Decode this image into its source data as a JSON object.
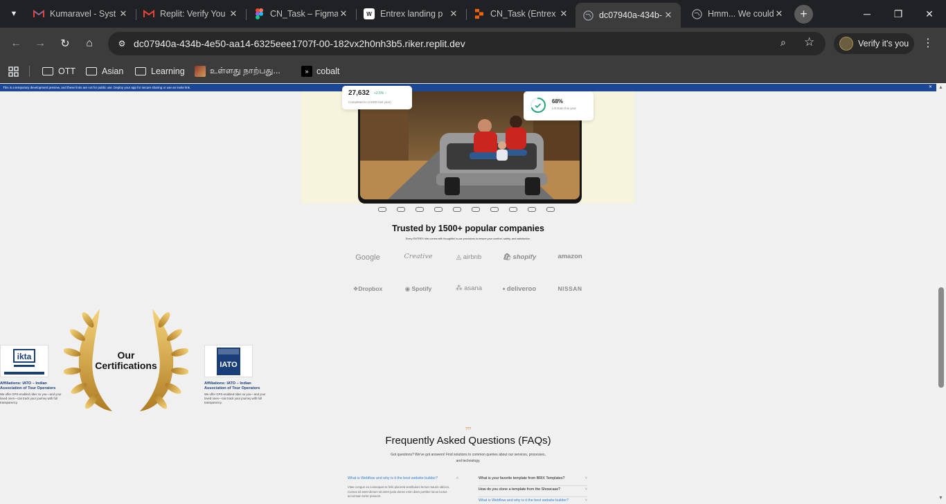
{
  "tabs": [
    {
      "title": "Kumaravel - Syst",
      "favicon": "gmail-icon"
    },
    {
      "title": "Replit: Verify You",
      "favicon": "gmail-icon"
    },
    {
      "title": "CN_Task – Figma",
      "favicon": "figma-icon"
    },
    {
      "title": "Entrex landing p",
      "favicon": "webflow-icon"
    },
    {
      "title": "CN_Task (Entrex",
      "favicon": "replit-icon"
    },
    {
      "title": "dc07940a-434b-",
      "favicon": "globe-icon",
      "active": true
    },
    {
      "title": "Hmm... We could",
      "favicon": "globe-icon"
    }
  ],
  "address_bar": {
    "url": "dc07940a-434b-4e50-aa14-6325eee1707f-00-182vx2h0nh3b5.riker.replit.dev"
  },
  "profile": {
    "label": "Verify it's you"
  },
  "bookmarks": [
    {
      "label": "OTT",
      "icon": "folder-icon"
    },
    {
      "label": "Asian",
      "icon": "folder-icon"
    },
    {
      "label": "Learning",
      "icon": "folder-icon"
    },
    {
      "label": "உள்ளது நாற்பது...",
      "icon": "image-icon"
    },
    {
      "label": "cobalt",
      "icon": "cobalt-icon"
    }
  ],
  "notice": {
    "text": "This is a temporary development preview, and these links are not for public use. Deploy your app for secure sharing or use an invite link."
  },
  "hero": {
    "stat1": {
      "value": "27,632",
      "change": "+2.5% ↑",
      "caption": "Completed to (21000 last year)"
    },
    "stat2": {
      "value": "68%",
      "caption": "Lift Rate this year",
      "progress": 0.68
    }
  },
  "carousel": {
    "dot_count": 10
  },
  "trusted": {
    "title": "Trusted by 1500+ popular companies",
    "subtitle": "Every ENTREX ride comes with thoughtful in-car provisions to ensure your comfort, safety, and satisfaction.",
    "logos_row1": [
      "Google",
      "Creative",
      "airbnb",
      "shopify",
      "amazon"
    ],
    "logos_row2": [
      "Dropbox",
      "Spotify",
      "asana",
      "deliveroo",
      "NISSAN"
    ]
  },
  "certifications": {
    "heading_line1": "Our",
    "heading_line2": "Certifications",
    "cards": [
      {
        "title": "Affiliations: IATO – Indian Association of Tour Operators",
        "desc": "We offer GPS-enabled rides so you—and your loved ones—can track your journey with full transparency."
      },
      {
        "title": "Affiliations: IATO – Indian Association of Tour Operators",
        "desc": "We offer GPS-enabled rides so you—and your loved ones—can track your journey with full transparency."
      }
    ]
  },
  "faq": {
    "tag": "???",
    "title": "Frequently Asked Questions (FAQs)",
    "subtitle": "Got questions? We've got answers! Find solutions to common queries about our services, processes, and technology.",
    "left": {
      "question": "What is Webflow and why is it the best website builder?",
      "answer": "Vitae congue eu consequat ac felis placerat vestibulum lectus mauris ultrices. Cursus sit amet dictum sit amet justo donec enim diam porttitor lacus luctus accumsan tortor posuere."
    },
    "right": [
      "What is your favorite template from BRIX Templates?",
      "How do you clone a template from the Showcase?",
      "What is Webflow and why is it the best website builder?"
    ]
  },
  "colors": {
    "accent_blue": "#1c4794",
    "faq_link_blue": "#2d7fd3",
    "hero_bg": "#f6f4dc",
    "tag_orange": "#e26a2c"
  }
}
